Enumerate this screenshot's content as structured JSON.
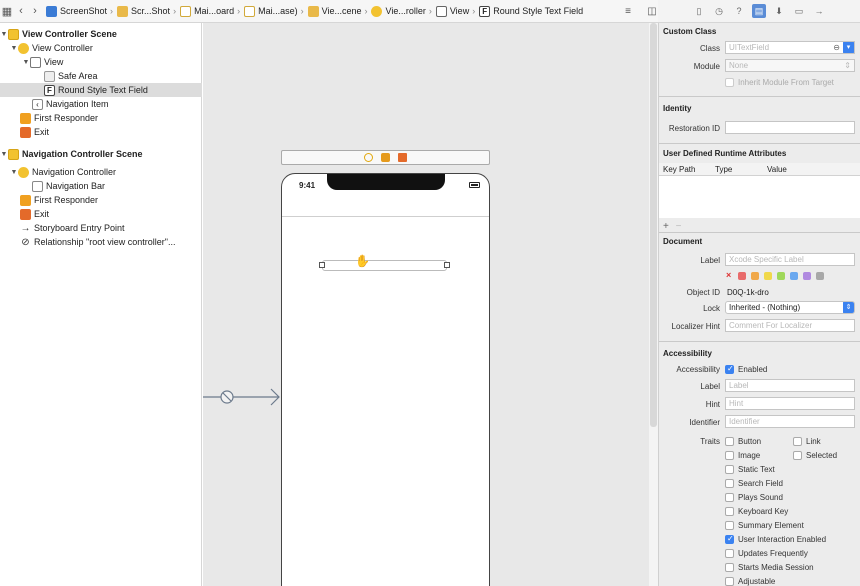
{
  "jumpbar": {
    "crumbs": [
      "ScreenShot",
      "Scr...Shot",
      "Mai...oard",
      "Mai...ase)",
      "Vie...cene",
      "Vie...roller",
      "View",
      "Round Style Text Field"
    ]
  },
  "outline": {
    "items": [
      {
        "label": "View Controller Scene"
      },
      {
        "label": "View Controller"
      },
      {
        "label": "View"
      },
      {
        "label": "Safe Area"
      },
      {
        "label": "Round Style Text Field"
      },
      {
        "label": "Navigation Item"
      },
      {
        "label": "First Responder"
      },
      {
        "label": "Exit"
      },
      {
        "label": "Navigation Controller Scene"
      },
      {
        "label": "Navigation Controller"
      },
      {
        "label": "Navigation Bar"
      },
      {
        "label": "First Responder"
      },
      {
        "label": "Exit"
      },
      {
        "label": "Storyboard Entry Point"
      },
      {
        "label": "Relationship \"root view controller\"..."
      }
    ]
  },
  "canvas": {
    "time": "9:41"
  },
  "inspector": {
    "custom_class": {
      "title": "Custom Class",
      "class_label": "Class",
      "class_value": "UITextField",
      "module_label": "Module",
      "module_value": "None",
      "inherit_label": "Inherit Module From Target"
    },
    "identity": {
      "title": "Identity",
      "restoration_label": "Restoration ID"
    },
    "runtime": {
      "title": "User Defined Runtime Attributes",
      "col_keypath": "Key Path",
      "col_type": "Type",
      "col_value": "Value",
      "add": "+",
      "remove": "−"
    },
    "document": {
      "title": "Document",
      "label_label": "Label",
      "label_placeholder": "Xcode Specific Label",
      "clear": "×",
      "colors": [
        "#e86b6b",
        "#f0a84a",
        "#f0d84a",
        "#9fd85a",
        "#6aa8ef",
        "#b08ae0",
        "#a8a8a8"
      ],
      "object_id_label": "Object ID",
      "object_id_value": "D0Q-1k-dro",
      "lock_label": "Lock",
      "lock_value": "Inherited - (Nothing)",
      "localizer_label": "Localizer Hint",
      "localizer_placeholder": "Comment For Localizer"
    },
    "accessibility": {
      "title": "Accessibility",
      "acc_label": "Accessibility",
      "enabled_label": "Enabled",
      "label_label": "Label",
      "label_placeholder": "Label",
      "hint_label": "Hint",
      "hint_placeholder": "Hint",
      "identifier_label": "Identifier",
      "identifier_placeholder": "Identifier",
      "traits_label": "Traits",
      "traits": [
        {
          "label": "Button",
          "checked": false
        },
        {
          "label": "Link",
          "checked": false
        },
        {
          "label": "Image",
          "checked": false
        },
        {
          "label": "Selected",
          "checked": false
        },
        {
          "label": "Static Text",
          "checked": false
        },
        {
          "label": "Search Field",
          "checked": false
        },
        {
          "label": "Plays Sound",
          "checked": false
        },
        {
          "label": "Keyboard Key",
          "checked": false
        },
        {
          "label": "Summary Element",
          "checked": false
        },
        {
          "label": "User Interaction Enabled",
          "checked": true
        },
        {
          "label": "Updates Frequently",
          "checked": false
        },
        {
          "label": "Starts Media Session",
          "checked": false
        },
        {
          "label": "Adjustable",
          "checked": false
        }
      ]
    }
  }
}
